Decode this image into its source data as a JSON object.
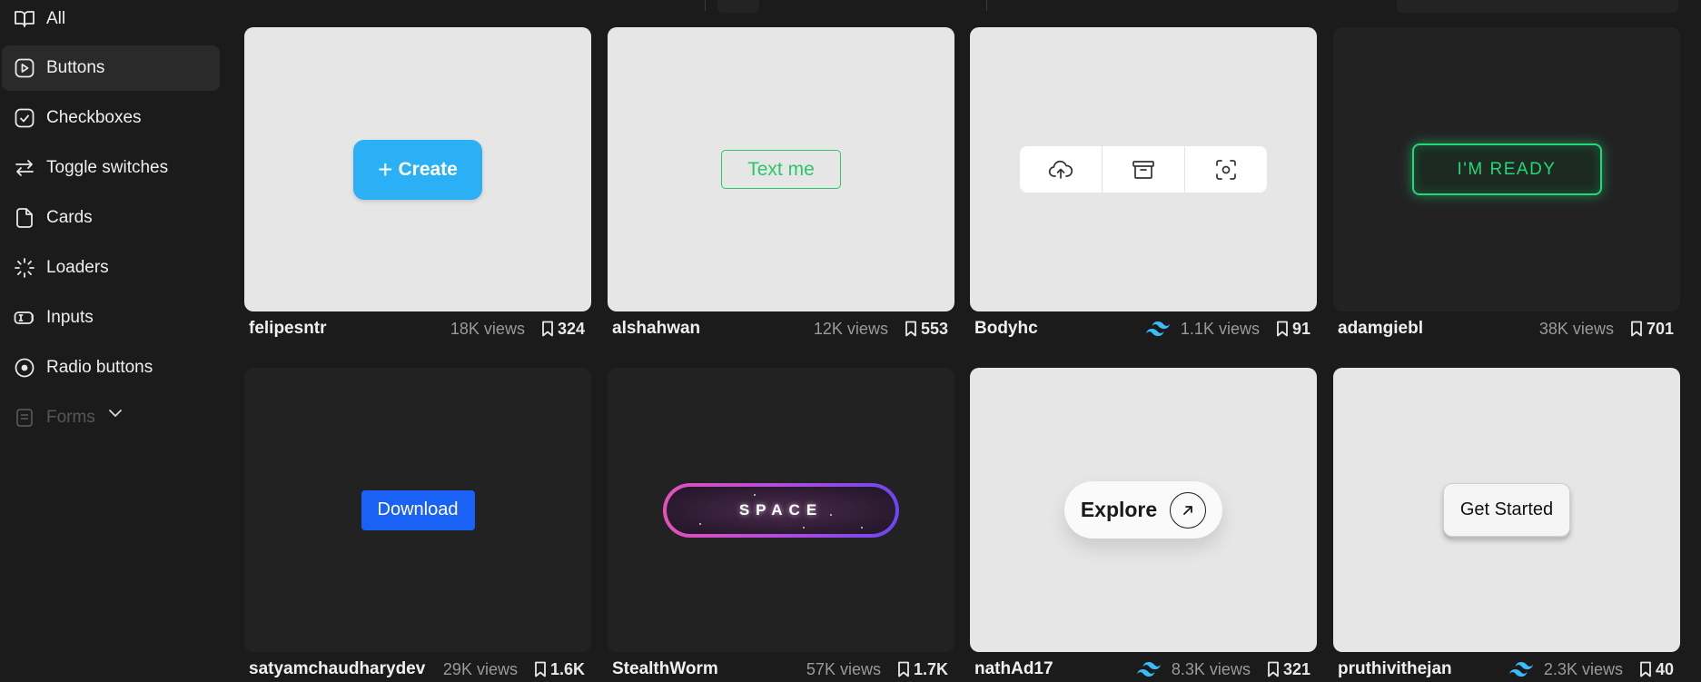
{
  "sidebar": {
    "items": [
      {
        "label": "All",
        "icon": "book-open-icon"
      },
      {
        "label": "Buttons",
        "icon": "play-square-icon",
        "active": true
      },
      {
        "label": "Checkboxes",
        "icon": "check-square-icon"
      },
      {
        "label": "Toggle switches",
        "icon": "arrows-swap-icon"
      },
      {
        "label": "Cards",
        "icon": "file-icon"
      },
      {
        "label": "Loaders",
        "icon": "loader-icon"
      },
      {
        "label": "Inputs",
        "icon": "input-icon"
      },
      {
        "label": "Radio buttons",
        "icon": "radio-icon"
      },
      {
        "label": "Forms",
        "icon": "form-icon"
      }
    ]
  },
  "cards": [
    {
      "author": "felipesntr",
      "views": "18K views",
      "bookmarks": "324",
      "tailwind": false,
      "demo_label": "Create",
      "theme": "light"
    },
    {
      "author": "alshahwan",
      "views": "12K views",
      "bookmarks": "553",
      "tailwind": false,
      "demo_label": "Text me",
      "theme": "light"
    },
    {
      "author": "Bodyhc",
      "views": "1.1K views",
      "bookmarks": "91",
      "tailwind": true,
      "demo_label": "",
      "theme": "light"
    },
    {
      "author": "adamgiebl",
      "views": "38K views",
      "bookmarks": "701",
      "tailwind": false,
      "demo_label": "I'M READY",
      "theme": "dark"
    },
    {
      "author": "satyamchaudharydev",
      "views": "29K views",
      "bookmarks": "1.6K",
      "tailwind": false,
      "demo_label": "Download",
      "theme": "dark"
    },
    {
      "author": "StealthWorm",
      "views": "57K views",
      "bookmarks": "1.7K",
      "tailwind": false,
      "demo_label": "SPACE",
      "theme": "dark"
    },
    {
      "author": "nathAd17",
      "views": "8.3K views",
      "bookmarks": "321",
      "tailwind": true,
      "demo_label": "Explore",
      "theme": "light"
    },
    {
      "author": "pruthivithejan",
      "views": "2.3K views",
      "bookmarks": "40",
      "tailwind": true,
      "demo_label": "Get Started",
      "theme": "light"
    }
  ],
  "colors": {
    "background": "#1b1b1b",
    "create_blue": "#2cb0f5",
    "text_me_green": "#2bc56b",
    "ready_green": "#22d877",
    "download_blue": "#1a62f5",
    "tailwind_cyan": "#38bdf8"
  }
}
